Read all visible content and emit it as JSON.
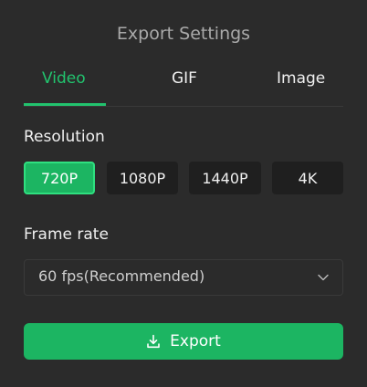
{
  "dialog": {
    "title": "Export Settings"
  },
  "tabs": [
    {
      "label": "Video",
      "active": true
    },
    {
      "label": "GIF",
      "active": false
    },
    {
      "label": "Image",
      "active": false
    }
  ],
  "resolution": {
    "label": "Resolution",
    "options": [
      "720P",
      "1080P",
      "1440P",
      "4K"
    ],
    "selected": "720P"
  },
  "frame_rate": {
    "label": "Frame rate",
    "selected": "60 fps(Recommended)"
  },
  "export_button": {
    "label": "Export",
    "icon": "download-icon"
  },
  "colors": {
    "accent": "#22c36e",
    "background": "#2b2b2b",
    "button_dark": "#1f1f1f"
  }
}
